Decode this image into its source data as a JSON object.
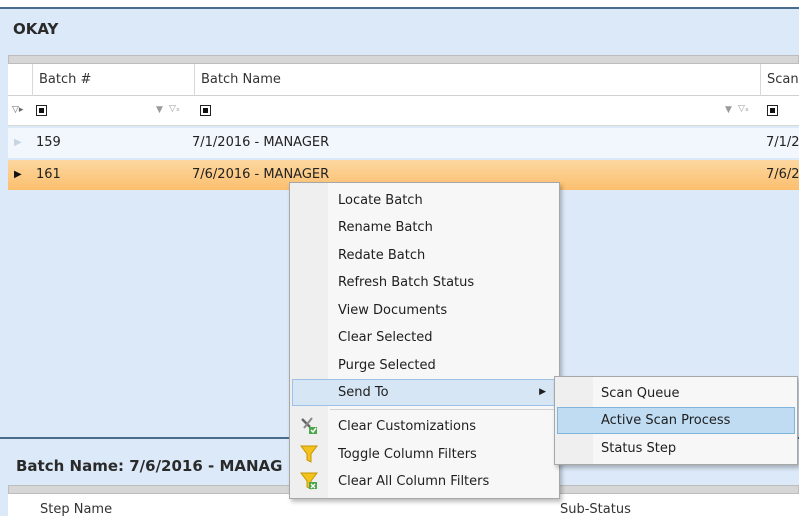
{
  "panel_title": "OKAY",
  "columns": [
    "Batch #",
    "Batch Name",
    "Scan"
  ],
  "rows": [
    {
      "batch": "159",
      "name": "7/1/2016 - MANAGER",
      "scan": "7/1/2"
    },
    {
      "batch": "161",
      "name": "7/6/2016 - MANAGER",
      "scan": "7/6/2"
    }
  ],
  "bottom_title": "Batch Name: 7/6/2016 - MANAG",
  "bottom_columns": [
    "Step Name",
    "Sub-Status"
  ],
  "context_menu": {
    "items": [
      "Locate Batch",
      "Rename Batch",
      "Redate Batch",
      "Refresh Batch Status",
      "View Documents",
      "Clear Selected",
      "Purge Selected"
    ],
    "send_to": "Send To",
    "extra": [
      {
        "label": "Clear Customizations",
        "icon": "tools-icon"
      },
      {
        "label": "Toggle Column Filters",
        "icon": "funnel-icon"
      },
      {
        "label": "Clear All Column Filters",
        "icon": "funnel-clear-icon"
      }
    ]
  },
  "submenu": [
    "Scan Queue",
    "Active Scan Process",
    "Status Step"
  ],
  "colors": {
    "selected_row": "#fbbf6e",
    "panel_bg": "#dce9f8",
    "highlight": "#bfdcf2"
  }
}
